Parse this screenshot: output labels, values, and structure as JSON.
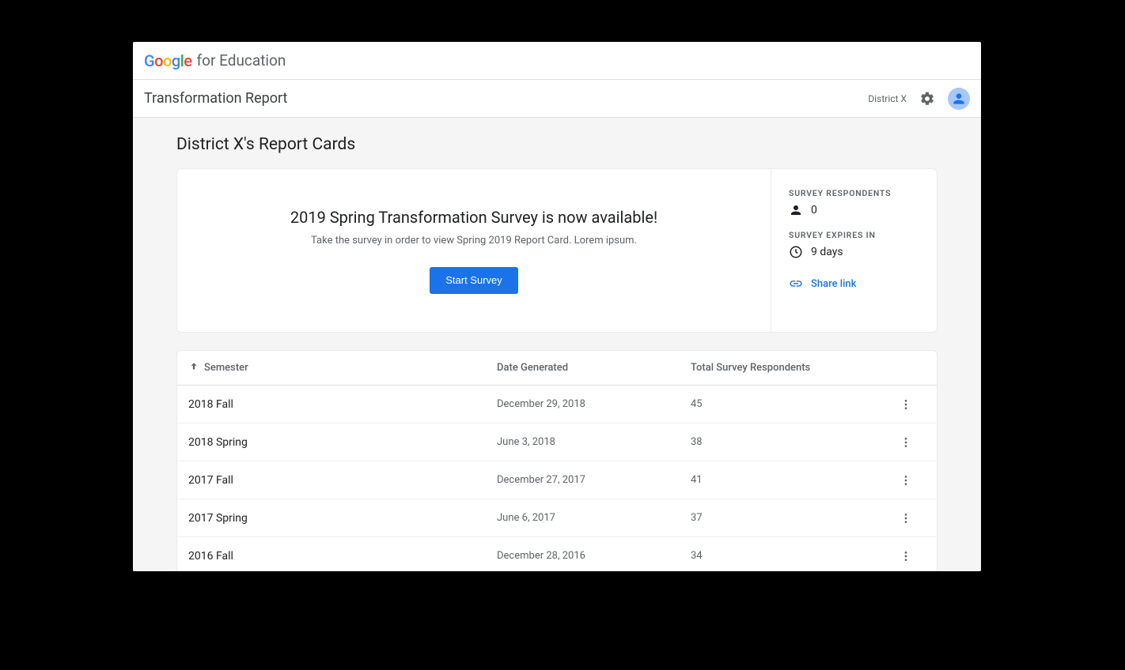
{
  "brand": {
    "google": "Google",
    "suffix": "for Education"
  },
  "header": {
    "title": "Transformation Report",
    "district": "District X"
  },
  "page": {
    "title": "District X's Report Cards"
  },
  "hero": {
    "title": "2019 Spring Transformation Survey is now available!",
    "subtitle": "Take the survey in order to view Spring 2019 Report Card. Lorem ipsum.",
    "button": "Start Survey"
  },
  "side": {
    "respondents_label": "SURVEY RESPONDENTS",
    "respondents_value": "0",
    "expires_label": "SURVEY EXPIRES IN",
    "expires_value": "9 days",
    "share_label": "Share link"
  },
  "table": {
    "headers": {
      "semester": "Semester",
      "date": "Date Generated",
      "respondents": "Total Survey Respondents"
    },
    "rows": [
      {
        "semester": "2018 Fall",
        "date": "December 29, 2018",
        "respondents": "45"
      },
      {
        "semester": "2018 Spring",
        "date": "June 3, 2018",
        "respondents": "38"
      },
      {
        "semester": "2017 Fall",
        "date": "December 27, 2017",
        "respondents": "41"
      },
      {
        "semester": "2017 Spring",
        "date": "June 6, 2017",
        "respondents": "37"
      },
      {
        "semester": "2016 Fall",
        "date": "December 28, 2016",
        "respondents": "34"
      }
    ]
  }
}
